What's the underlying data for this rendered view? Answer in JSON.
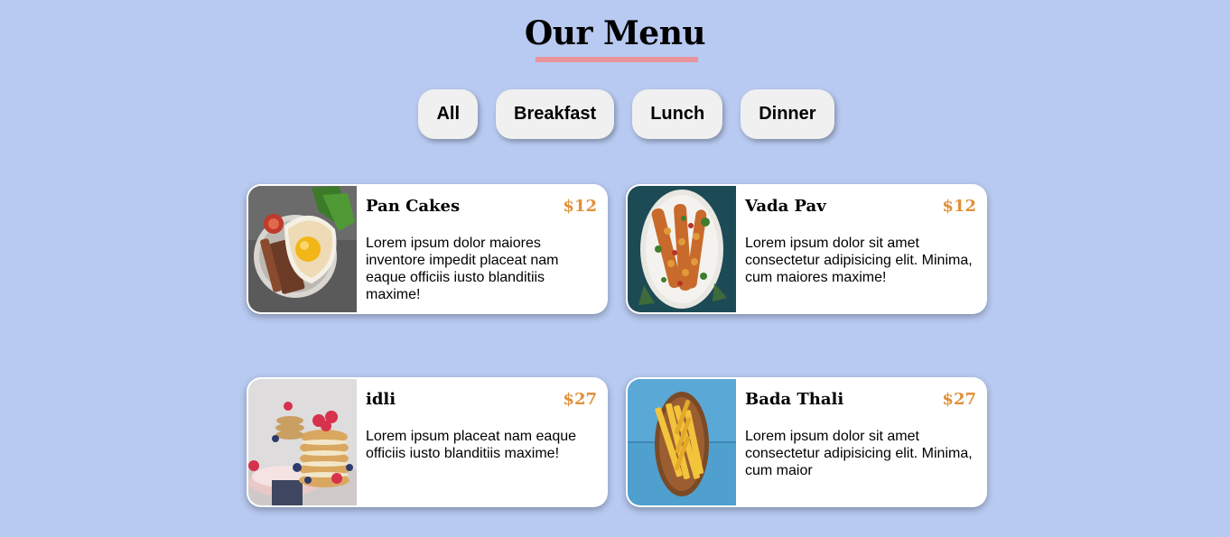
{
  "header": {
    "title": "Our Menu"
  },
  "filters": {
    "all": "All",
    "breakfast": "Breakfast",
    "lunch": "Lunch",
    "dinner": "Dinner"
  },
  "colors": {
    "background": "#b8caf1",
    "accent_underline": "#e8959b",
    "price": "#e0903a"
  },
  "menu": {
    "items": [
      {
        "name": "Pan Cakes",
        "price": "$12",
        "description": "Lorem ipsum dolor maiores inventore impedit placeat nam eaque officiis iusto blanditiis maxime!",
        "image": "fried-egg-toast-plate-image"
      },
      {
        "name": "Vada Pav",
        "price": "$12",
        "description": "Lorem ipsum dolor sit amet consectetur adipisicing elit. Minima, cum maiores maxime!",
        "image": "skewers-plate-image"
      },
      {
        "name": "idli",
        "price": "$27",
        "description": "Lorem ipsum placeat nam eaque officiis iusto blanditiis maxime!",
        "image": "pancake-stack-berries-image"
      },
      {
        "name": "Bada Thali",
        "price": "$27",
        "description": "Lorem ipsum dolor sit amet consectetur adipisicing elit. Minima, cum maior",
        "image": "fries-bowl-image"
      }
    ]
  }
}
